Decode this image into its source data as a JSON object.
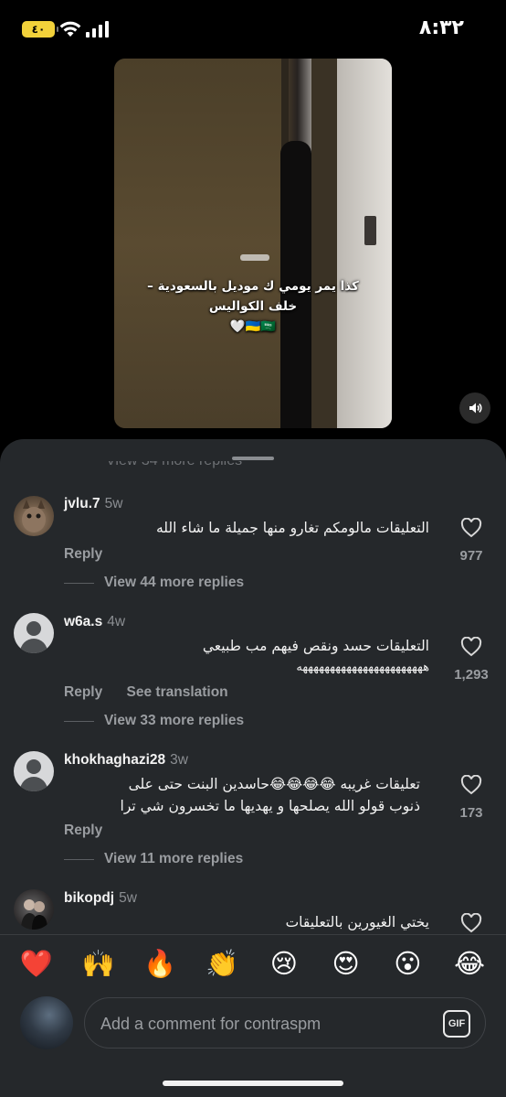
{
  "status_bar": {
    "battery": "٤٠",
    "time": "٨:٣٢"
  },
  "video": {
    "caption_line1": "كذا يمر يومي ك موديل بالسعودية –",
    "caption_line2": "خلف الكواليس",
    "caption_line3": "🇺🇦🇸🇦🤍"
  },
  "comments": {
    "partial_hidden": "View 34 more replies",
    "items": [
      {
        "username": "jvlu.7",
        "age": "5w",
        "text": [
          "التعليقات مالومكم تغارو منها جميلة ما شاء الله"
        ],
        "reply_label": "Reply",
        "likes": "977",
        "view_more": "View 44 more replies"
      },
      {
        "username": "w6a.s",
        "age": "4w",
        "text": [
          "التعليقات حسد ونقص فيهم مب طبيعي",
          "هههههههههههههههههههههههه"
        ],
        "reply_label": "Reply",
        "see_translation": "See translation",
        "likes": "1,293",
        "view_more": "View 33 more replies"
      },
      {
        "username": "khokhaghazi28",
        "age": "3w",
        "text": [
          "تعليقات غريبه 😂😂😂😂حاسدين البنت حتى على",
          "ذنوب قولو الله يصلحها و يهديها ما تخسرون شي ترا"
        ],
        "reply_label": "Reply",
        "likes": "173",
        "view_more": "View 11 more replies"
      },
      {
        "username": "bikopdj",
        "age": "5w",
        "text": [
          "يختي الغيورين بالتعليقات"
        ]
      }
    ]
  },
  "emoji_bar": [
    "❤️",
    "🙌",
    "🔥",
    "👏",
    "😢",
    "😍",
    "😮",
    "😂"
  ],
  "input": {
    "placeholder": "Add a comment for contraspm",
    "gif_label": "GIF"
  }
}
